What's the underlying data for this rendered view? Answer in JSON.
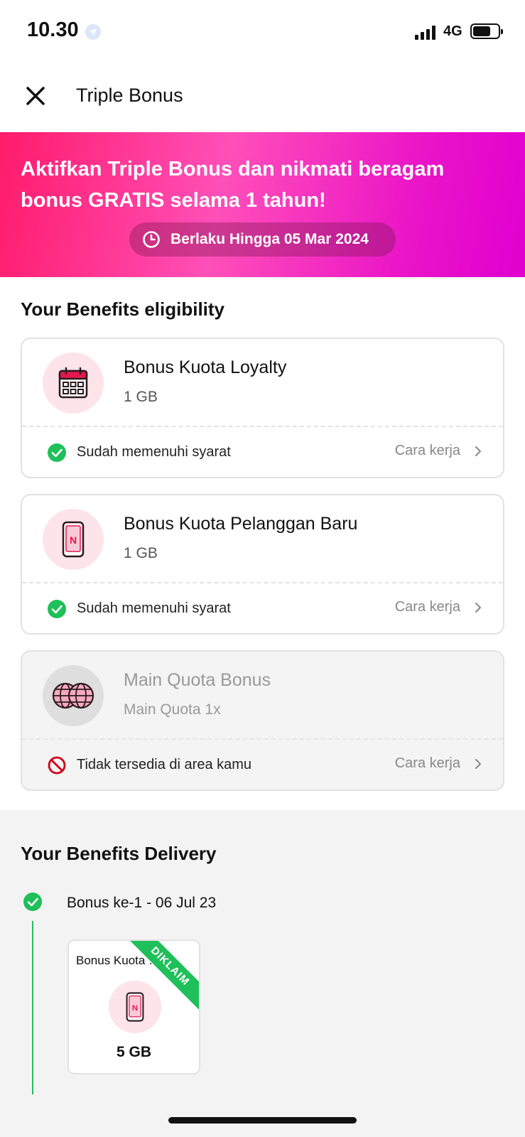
{
  "status_bar": {
    "time": "10.30",
    "network": "4G"
  },
  "header": {
    "title": "Triple Bonus"
  },
  "banner": {
    "headline": "Aktifkan Triple Bonus dan nikmati beragam bonus GRATIS selama 1 tahun!",
    "validity": "Berlaku Hingga 05 Mar 2024"
  },
  "eligibility": {
    "title": "Your Benefits eligibility",
    "cards": [
      {
        "title": "Bonus Kuota Loyalty",
        "subtitle": "1 GB",
        "status": "Sudah memenuhi syarat",
        "link": "Cara kerja",
        "icon": "calendar-icon",
        "eligible": true
      },
      {
        "title": "Bonus Kuota Pelanggan Baru",
        "subtitle": "1 GB",
        "status": "Sudah memenuhi syarat",
        "link": "Cara kerja",
        "icon": "phone-icon",
        "eligible": true
      },
      {
        "title": "Main Quota Bonus",
        "subtitle": "Main Quota 1x",
        "status": "Tidak tersedia di area kamu",
        "link": "Cara kerja",
        "icon": "globe-icon",
        "eligible": false
      }
    ]
  },
  "delivery": {
    "title": "Your Benefits Delivery",
    "entries": [
      {
        "label": "Bonus ke-1 - 06 Jul 23",
        "card": {
          "title": "Bonus Kuota Pelanggan Baru",
          "value": "5 GB",
          "badge": "DIKLAIM"
        }
      }
    ]
  },
  "colors": {
    "brand": "#ff1b6b",
    "brand_end": "#e000d0",
    "success": "#1fbf5a",
    "error": "#d0021b"
  }
}
